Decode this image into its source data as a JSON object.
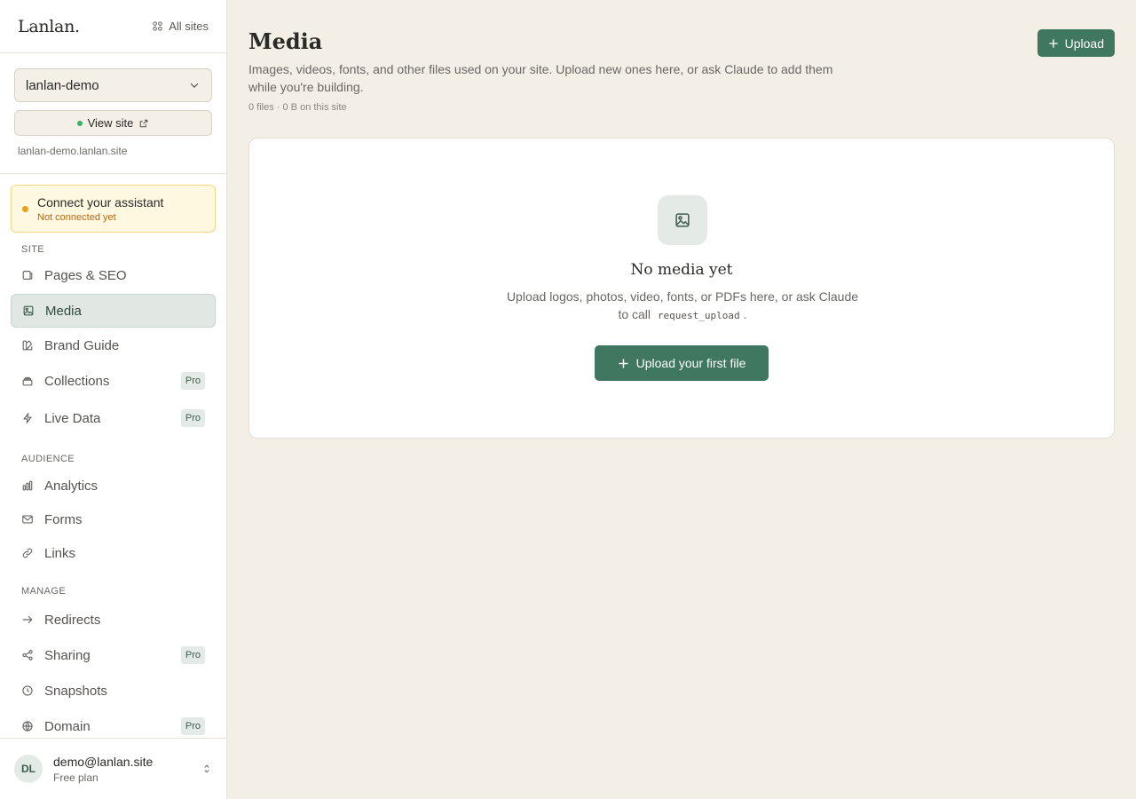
{
  "brand": {
    "logo": "Lanlan.",
    "all_sites": "All sites"
  },
  "site": {
    "selected": "lanlan-demo",
    "view_site": "View site",
    "url": "lanlan-demo.lanlan.site"
  },
  "assistant": {
    "title": "Connect your assistant",
    "status": "Not connected yet"
  },
  "nav": {
    "site_label": "SITE",
    "site_items": [
      {
        "label": "Pages & SEO",
        "icon": "pages-icon",
        "pro": false,
        "active": false
      },
      {
        "label": "Media",
        "icon": "image-icon",
        "pro": false,
        "active": true
      },
      {
        "label": "Brand Guide",
        "icon": "brand-icon",
        "pro": false,
        "active": false
      },
      {
        "label": "Collections",
        "icon": "collections-icon",
        "pro": true,
        "active": false
      },
      {
        "label": "Live Data",
        "icon": "bolt-icon",
        "pro": true,
        "active": false
      }
    ],
    "audience_label": "AUDIENCE",
    "audience_items": [
      {
        "label": "Analytics",
        "icon": "analytics-icon"
      },
      {
        "label": "Forms",
        "icon": "mail-icon"
      },
      {
        "label": "Links",
        "icon": "link-icon"
      }
    ],
    "manage_label": "MANAGE",
    "manage_items": [
      {
        "label": "Redirects",
        "icon": "arrow-right-icon",
        "pro": false
      },
      {
        "label": "Sharing",
        "icon": "share-icon",
        "pro": true
      },
      {
        "label": "Snapshots",
        "icon": "clock-icon",
        "pro": false
      },
      {
        "label": "Domain",
        "icon": "globe-icon",
        "pro": true
      }
    ],
    "pro_label": "Pro"
  },
  "user": {
    "initials": "DL",
    "email": "demo@lanlan.site",
    "plan": "Free plan"
  },
  "main": {
    "title": "Media",
    "description": "Images, videos, fonts, and other files used on your site. Upload new ones here, or ask Claude to add them while you're building.",
    "meta": "0 files · 0 B on this site",
    "upload_label": "Upload",
    "empty": {
      "title": "No media yet",
      "desc_before": "Upload logos, photos, video, fonts, or PDFs here, or ask Claude to call",
      "desc_code": "request_upload",
      "desc_after": ".",
      "button": "Upload your first file"
    }
  },
  "colors": {
    "accent": "#3f7760",
    "background": "#f3eee6",
    "warning": "#eaa212",
    "online": "#34b36a"
  }
}
